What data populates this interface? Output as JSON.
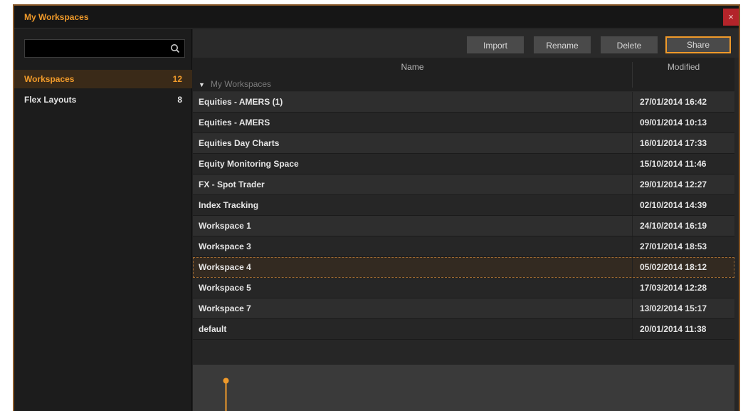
{
  "window": {
    "title": "My Workspaces",
    "close_label": "×"
  },
  "sidebar": {
    "search_placeholder": "",
    "items": [
      {
        "label": "Workspaces",
        "count": "12",
        "active": true
      },
      {
        "label": "Flex Layouts",
        "count": "8",
        "active": false
      }
    ]
  },
  "toolbar": {
    "import_label": "Import",
    "rename_label": "Rename",
    "delete_label": "Delete",
    "share_label": "Share"
  },
  "table": {
    "headers": {
      "name": "Name",
      "modified": "Modified"
    },
    "group_label": "My Workspaces",
    "rows": [
      {
        "name": "Equities - AMERS (1)",
        "modified": "27/01/2014 16:42"
      },
      {
        "name": "Equities - AMERS",
        "modified": "09/01/2014 10:13"
      },
      {
        "name": "Equities Day Charts",
        "modified": "16/01/2014 17:33"
      },
      {
        "name": "Equity Monitoring Space",
        "modified": "15/10/2014 11:46"
      },
      {
        "name": "FX - Spot Trader",
        "modified": "29/01/2014 12:27"
      },
      {
        "name": "Index Tracking",
        "modified": "02/10/2014 14:39"
      },
      {
        "name": "Workspace 1",
        "modified": "24/10/2014 16:19"
      },
      {
        "name": "Workspace 3",
        "modified": "27/01/2014 18:53"
      },
      {
        "name": "Workspace 4",
        "modified": "05/02/2014 18:12"
      },
      {
        "name": "Workspace 5",
        "modified": "17/03/2014 12:28"
      },
      {
        "name": "Workspace 7",
        "modified": "13/02/2014 15:17"
      },
      {
        "name": "default",
        "modified": "20/01/2014 11:38"
      }
    ]
  },
  "colors": {
    "accent": "#f09a2a",
    "close": "#b3242a",
    "border": "#8a5a2a"
  }
}
